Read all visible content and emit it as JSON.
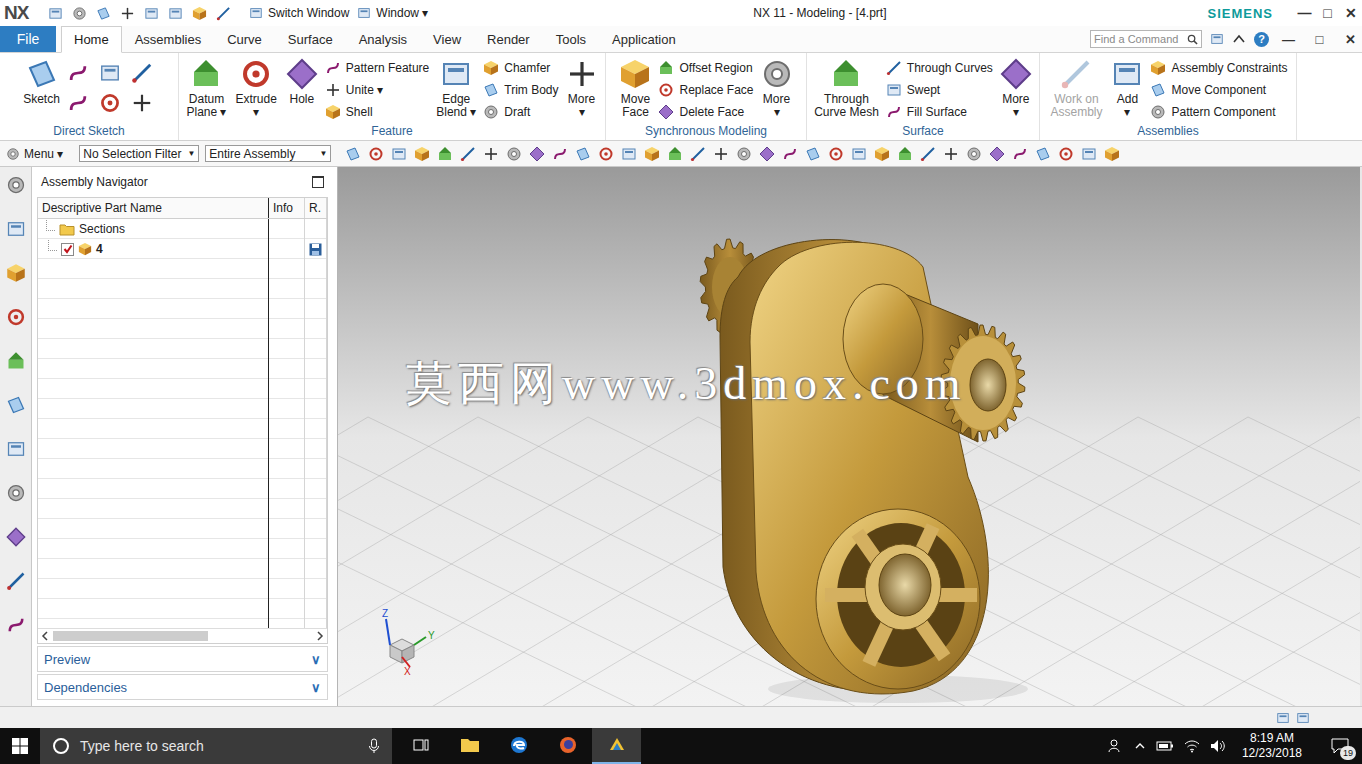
{
  "titlebar": {
    "logo": "NX",
    "switch_window": "Switch Window",
    "window_menu": "Window ▾",
    "title": "NX 11 - Modeling - [4.prt]",
    "brand": "SIEMENS",
    "controls": [
      "—",
      "□",
      "✕"
    ]
  },
  "ribbon_tabs": [
    {
      "label": "File",
      "selected": false,
      "kind": "file"
    },
    {
      "label": "Home",
      "selected": true,
      "kind": "tab"
    },
    {
      "label": "Assemblies",
      "selected": false,
      "kind": "tab"
    },
    {
      "label": "Curve",
      "selected": false,
      "kind": "tab"
    },
    {
      "label": "Surface",
      "selected": false,
      "kind": "tab"
    },
    {
      "label": "Analysis",
      "selected": false,
      "kind": "tab"
    },
    {
      "label": "View",
      "selected": false,
      "kind": "tab"
    },
    {
      "label": "Render",
      "selected": false,
      "kind": "tab"
    },
    {
      "label": "Tools",
      "selected": false,
      "kind": "tab"
    },
    {
      "label": "Application",
      "selected": false,
      "kind": "tab"
    }
  ],
  "command_search": {
    "placeholder": "Find a Command"
  },
  "ribbon_help": "?",
  "ribbon_controls": [
    "—",
    "□",
    "✕"
  ],
  "ribbon_groups": [
    {
      "label": "Direct Sketch",
      "columns": [
        {
          "kind": "large",
          "lines": [
            "Sketch"
          ],
          "disabled": false
        },
        {
          "kind": "grid"
        }
      ]
    },
    {
      "label": "Feature",
      "columns": [
        {
          "kind": "large",
          "lines": [
            "Datum",
            "Plane ▾"
          ],
          "disabled": false
        },
        {
          "kind": "large",
          "lines": [
            "Extrude",
            "▾"
          ],
          "disabled": false
        },
        {
          "kind": "large",
          "lines": [
            "Hole"
          ],
          "disabled": false
        },
        {
          "kind": "stack",
          "items": [
            "Pattern Feature",
            "Unite ▾",
            "Shell"
          ]
        },
        {
          "kind": "large",
          "lines": [
            "Edge",
            "Blend ▾"
          ],
          "disabled": false
        },
        {
          "kind": "stack",
          "items": [
            "Chamfer",
            "Trim Body",
            "Draft"
          ]
        },
        {
          "kind": "large",
          "lines": [
            "More",
            "▾"
          ],
          "disabled": false
        }
      ]
    },
    {
      "label": "Synchronous Modeling",
      "columns": [
        {
          "kind": "large",
          "lines": [
            "Move",
            "Face"
          ],
          "disabled": false
        },
        {
          "kind": "stack",
          "items": [
            "Offset Region",
            "Replace Face",
            "Delete Face"
          ]
        },
        {
          "kind": "large",
          "lines": [
            "More",
            "▾"
          ],
          "disabled": false
        }
      ]
    },
    {
      "label": "Surface",
      "columns": [
        {
          "kind": "large",
          "lines": [
            "Through",
            "Curve Mesh"
          ],
          "disabled": false
        },
        {
          "kind": "stack",
          "items": [
            "Through Curves",
            "Swept",
            "Fill Surface"
          ]
        },
        {
          "kind": "large",
          "lines": [
            "More",
            "▾"
          ],
          "disabled": false
        }
      ]
    },
    {
      "label": "Assemblies",
      "columns": [
        {
          "kind": "large",
          "lines": [
            "Work on",
            "Assembly"
          ],
          "disabled": true
        },
        {
          "kind": "large",
          "lines": [
            "Add",
            "▾"
          ],
          "disabled": false
        },
        {
          "kind": "stack",
          "items": [
            "Assembly Constraints",
            "Move Component",
            "Pattern Component"
          ]
        }
      ]
    }
  ],
  "selection_bar": {
    "menu": "Menu ▾",
    "filters": [
      {
        "label": "No Selection Filter",
        "arrow": "▼"
      },
      {
        "label": "Entire Assembly",
        "arrow": "▼"
      }
    ]
  },
  "navigator": {
    "title": "Assembly Navigator",
    "columns": [
      "Descriptive Part Name",
      "Info",
      "R."
    ],
    "rows": [
      {
        "name": "Sections",
        "kind": "folder"
      },
      {
        "name": "4",
        "kind": "part",
        "checked": true,
        "saved": true
      }
    ],
    "panels": [
      {
        "label": "Preview",
        "expanded": false,
        "toggle": "∨"
      },
      {
        "label": "Dependencies",
        "expanded": false,
        "toggle": "∨"
      }
    ]
  },
  "viewport": {
    "watermark": "莫西网www.3dmox.com",
    "axes": [
      "Z",
      "Y",
      "X"
    ]
  },
  "taskbar": {
    "search": {
      "placeholder": "Type here to search"
    },
    "time": "8:19 AM",
    "date": "12/23/2018",
    "notifications": "19"
  }
}
